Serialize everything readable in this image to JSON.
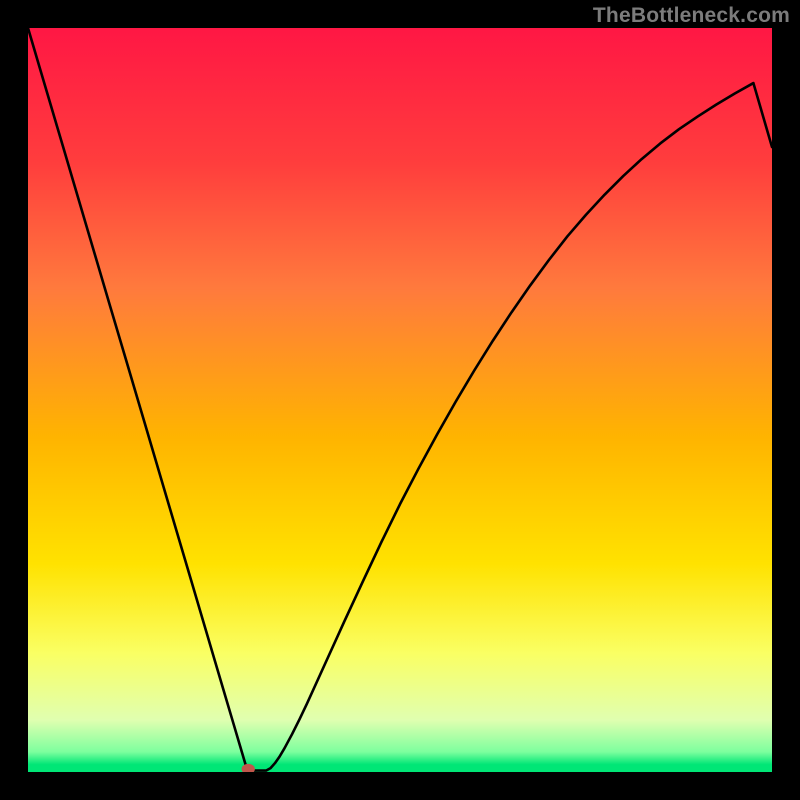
{
  "watermark": "TheBottleneck.com",
  "chart_data": {
    "type": "line",
    "title": "",
    "xlabel": "",
    "ylabel": "",
    "xlim": [
      0,
      100
    ],
    "ylim": [
      0,
      100
    ],
    "series": [
      {
        "name": "curve",
        "color": "#000000",
        "x": [
          0.0,
          1.57,
          3.14,
          4.71,
          6.28,
          7.85,
          9.42,
          10.99,
          12.57,
          14.14,
          15.71,
          17.28,
          18.85,
          20.42,
          21.99,
          23.56,
          25.13,
          26.7,
          27.49,
          28.5,
          29.0,
          29.3,
          29.5,
          29.8,
          30.1,
          30.45,
          30.8,
          31.2,
          31.6,
          32.0,
          32.6,
          33.2,
          33.8,
          34.48,
          35.5,
          36.5,
          37.5,
          40.0,
          42.5,
          45.0,
          47.5,
          50.0,
          52.5,
          55.0,
          57.5,
          60.0,
          62.5,
          65.0,
          67.5,
          70.0,
          72.5,
          75.0,
          77.5,
          80.0,
          82.5,
          85.0,
          87.5,
          90.0,
          92.5,
          95.0,
          97.5,
          100.0
        ],
        "values": [
          100.0,
          94.68,
          89.36,
          84.05,
          78.73,
          73.41,
          68.09,
          62.77,
          57.45,
          52.14,
          46.82,
          41.5,
          36.18,
          30.86,
          25.55,
          20.23,
          14.91,
          9.59,
          6.93,
          3.51,
          1.82,
          0.8,
          0.19,
          0.19,
          0.19,
          0.19,
          0.19,
          0.19,
          0.19,
          0.19,
          0.52,
          1.2,
          2.05,
          3.2,
          5.1,
          7.1,
          9.2,
          14.7,
          20.2,
          25.6,
          30.9,
          36.0,
          40.8,
          45.4,
          49.8,
          54.0,
          58.0,
          61.8,
          65.4,
          68.8,
          72.0,
          74.9,
          77.6,
          80.1,
          82.4,
          84.5,
          86.4,
          88.1,
          89.7,
          91.2,
          92.6,
          84.0
        ]
      }
    ],
    "background": {
      "type": "vertical-gradient",
      "stops": [
        {
          "offset": 0.0,
          "color": "#ff1744"
        },
        {
          "offset": 0.18,
          "color": "#ff3d3d"
        },
        {
          "offset": 0.35,
          "color": "#ff7a3d"
        },
        {
          "offset": 0.55,
          "color": "#ffb400"
        },
        {
          "offset": 0.72,
          "color": "#ffe200"
        },
        {
          "offset": 0.84,
          "color": "#faff63"
        },
        {
          "offset": 0.93,
          "color": "#e0ffb0"
        },
        {
          "offset": 0.973,
          "color": "#7dff9e"
        },
        {
          "offset": 0.99,
          "color": "#00e676"
        },
        {
          "offset": 1.0,
          "color": "#00e676"
        }
      ]
    },
    "marker": {
      "x": 29.6,
      "y": 0.4,
      "rx": 0.9,
      "ry": 0.7,
      "color": "#c0564b"
    }
  }
}
